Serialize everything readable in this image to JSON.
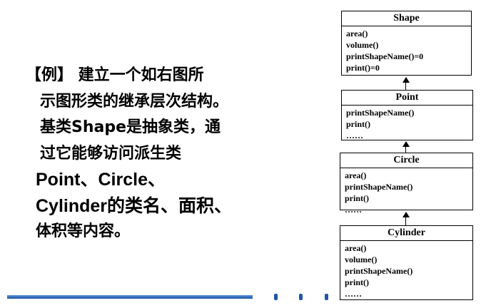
{
  "text": {
    "line1": "【例】 建立一个如右图所",
    "line2": "示图形类的继承层次结构。",
    "line3": "基类Shape是抽象类，通",
    "line4": "过它能够访问派生类",
    "line5": "Point、Circle、",
    "line6": "Cylinder的类名、面积、",
    "line7": "体积等内容。"
  },
  "classes": [
    {
      "name": "Shape",
      "methods": [
        "area()",
        "volume()",
        "printShapeName()=0",
        "print()=0"
      ]
    },
    {
      "name": "Point",
      "methods": [
        "printShapeName()",
        "print()",
        "……"
      ]
    },
    {
      "name": "Circle",
      "methods": [
        "area()",
        "printShapeName()",
        "print()",
        "……"
      ]
    },
    {
      "name": "Cylinder",
      "methods": [
        "area()",
        "volume()",
        "printShapeName()",
        "print()",
        "……"
      ]
    }
  ],
  "colors": {
    "accent": "#1f55a8"
  }
}
